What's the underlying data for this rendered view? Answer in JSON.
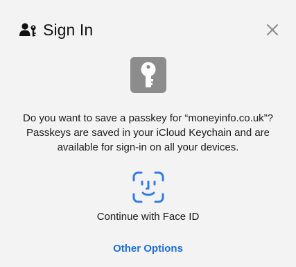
{
  "dialog": {
    "title": "Sign In",
    "icons": {
      "header": "person-key-icon",
      "close": "close-icon",
      "app": "key-icon",
      "biometric": "face-id-icon"
    },
    "message_lines": [
      "Do you want to save a passkey for “moneyinfo.co.uk”?",
      "Passkeys are saved in your iCloud Keychain and are",
      "available for sign-in on all your devices."
    ],
    "face_id_label": "Continue with Face ID",
    "other_options_label": "Other Options"
  },
  "colors": {
    "background": "#f3f3f3",
    "accent": "#1f6fd0",
    "key_tile": "#8c8c8c",
    "text": "#1a1a1a"
  }
}
